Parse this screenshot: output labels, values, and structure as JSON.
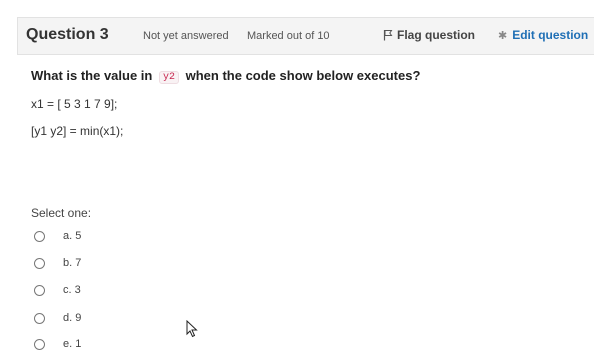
{
  "header": {
    "title": "Question 3",
    "state": "Not yet answered",
    "grade": "Marked out of 10",
    "flag_label": "Flag question",
    "edit_label": "Edit question"
  },
  "question": {
    "text_before": "What is the value in",
    "code_var": "y2",
    "text_after": "when the code show below executes?",
    "code_lines": [
      "x1 = [ 5 3 1 7 9];",
      "[y1 y2] = min(x1);"
    ]
  },
  "answer": {
    "prompt": "Select one:",
    "options": [
      "a. 5",
      "b. 7",
      "c. 3",
      "d. 9",
      "e. 1"
    ]
  }
}
